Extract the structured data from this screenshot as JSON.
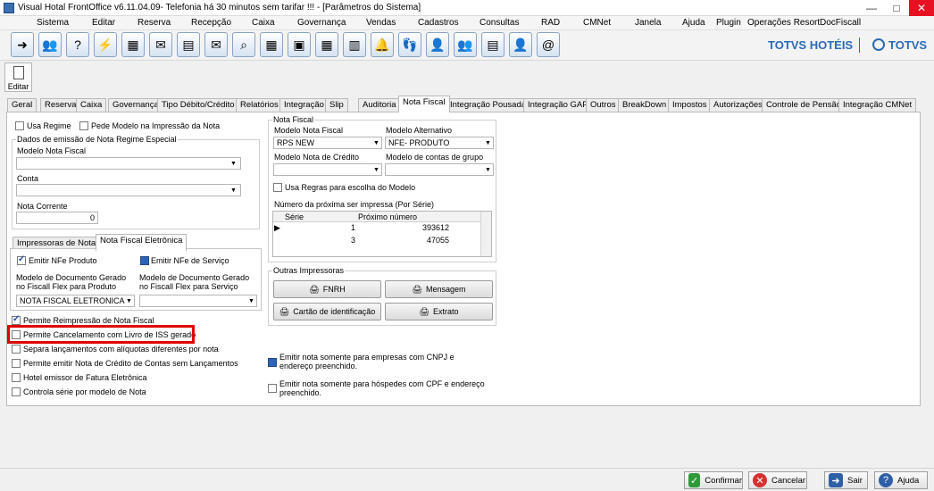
{
  "window": {
    "title": "Visual Hotal FrontOffice v6.11.04.09- Telefonia há 30 minutos sem tarifar !!! - [Parâmetros do Sistema]",
    "minimize": "—",
    "maximize": "□",
    "close": "✕"
  },
  "menu": [
    "Sistema",
    "Editar",
    "Reserva",
    "Recepção",
    "Caixa",
    "Governança",
    "Vendas",
    "Cadastros",
    "Consultas",
    "RAD",
    "CMNet",
    "Janela",
    "Ajuda",
    "Plugin",
    "Operações Resort",
    "DocFiscall"
  ],
  "toolbar": {
    "icons": [
      "exit-icon",
      "users-icon",
      "help-icon",
      "lightning-icon",
      "network-icon",
      "mail-icon",
      "form-icon",
      "envelope-arrow-icon",
      "search-icon",
      "calendar-icon",
      "card-icon",
      "grid-icon",
      "cards-icon",
      "bell-icon",
      "footprints-icon",
      "user-add-icon",
      "group-icon",
      "register-icon",
      "guest-icon",
      "at-email-icon"
    ],
    "glyphs": [
      "➜",
      "👥",
      "?",
      "⚡",
      "▦",
      "✉",
      "▤",
      "✉",
      "⌕",
      "▦",
      "▣",
      "▦",
      "▥",
      "🔔",
      "👣",
      "👤",
      "👥",
      "▤",
      "👤",
      "@"
    ]
  },
  "brand": {
    "left": "TOTVS HOTÉIS",
    "right": "TOTVS"
  },
  "edit_button": {
    "label": "Editar"
  },
  "tabs": [
    "Geral",
    "Reserva",
    "Caixa",
    "Governança",
    "Tipo Débito/Crédito",
    "Relatórios",
    "Integração",
    "Slip",
    "Auditoria",
    "Nota Fiscal",
    "Integração Pousada",
    "Integração GAP",
    "Outros",
    "BreakDown",
    "Impostos",
    "Autorizações",
    "Controle de Pensão",
    "Integração CMNet"
  ],
  "active_tab": "Nota Fiscal",
  "left": {
    "usa_regime": "Usa Regime",
    "pede_modelo": "Pede Modelo na Impressão da Nota",
    "dados_group": "Dados de emissão de Nota Regime Especial",
    "modelo_nota_fiscal": "Modelo Nota Fiscal",
    "conta": "Conta",
    "nota_corrente": "Nota Corrente",
    "nota_corrente_value": "0",
    "sub_tabs": [
      "Impressoras de Notas",
      "Nota Fiscal Eletrônica"
    ],
    "emitir_nfe_produto": "Emitir NFe Produto",
    "emitir_nfe_servico": "Emitir NFe de Serviço",
    "modelo_doc_produto": "Modelo de Documento Gerado no Fiscall Flex para Produto",
    "modelo_doc_servico": "Modelo de Documento Gerado no Fiscall Flex para Serviço",
    "modelo_doc_produto_value": "NOTA FISCAL ELETRONICA",
    "checks": [
      "Permite Reimpressão de Nota Fiscal",
      "Permite Cancelamento com Livro de ISS gerado",
      "Separa lançamentos com alíquotas diferentes por nota",
      "Permite emitir Nota de Crédito de Contas sem Lançamentos",
      "Hotel emissor de Fatura Eletrônica",
      "Controla série por modelo de Nota"
    ]
  },
  "right": {
    "nota_fiscal_group": "Nota Fiscal",
    "modelo_nota_fiscal": "Modelo Nota Fiscal",
    "modelo_nota_fiscal_value": "RPS NEW",
    "modelo_alternativo": "Modelo Alternativo",
    "modelo_alternativo_value": "NFE- PRODUTO",
    "modelo_nota_credito": "Modelo Nota de Crédito",
    "modelo_contas_grupo": "Modelo de contas de grupo",
    "usa_regras": "Usa Regras para escolha do Modelo",
    "numero_proxima": "Número da próxima ser impressa (Por Série)",
    "grid": {
      "headers": [
        "Série",
        "Próximo número"
      ],
      "rows": [
        [
          "1",
          "393612"
        ],
        [
          "3",
          "47055"
        ]
      ]
    },
    "outras_group": "Outras Impressoras",
    "buttons": [
      "FNRH",
      "Mensagem",
      "Cartão de identificação",
      "Extrato"
    ],
    "emitir_cnpj": "Emitir nota somente para empresas com CNPJ e endereço preenchido.",
    "emitir_cpf": "Emitir nota somente para hóspedes com CPF e endereço preenchido."
  },
  "bottom": {
    "confirmar": "Confirmar",
    "cancelar": "Cancelar",
    "sair": "Sair",
    "ajuda": "Ajuda"
  }
}
